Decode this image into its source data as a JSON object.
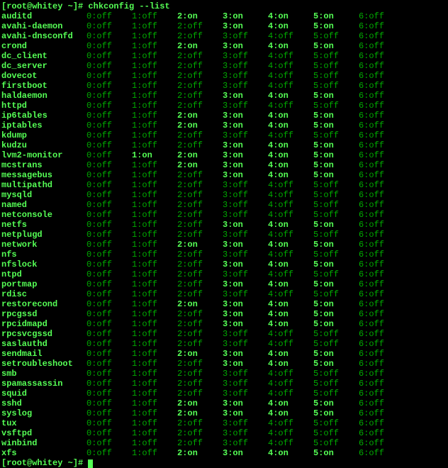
{
  "prompt1": "[root@whitey ~]# chkconfig --list",
  "prompt2": "[root@whitey ~]# ",
  "services": [
    {
      "name": "auditd",
      "levels": [
        "0:off",
        "1:off",
        "2:on",
        "3:on",
        "4:on",
        "5:on",
        "6:off"
      ]
    },
    {
      "name": "avahi-daemon",
      "levels": [
        "0:off",
        "1:off",
        "2:off",
        "3:on",
        "4:on",
        "5:on",
        "6:off"
      ]
    },
    {
      "name": "avahi-dnsconfd",
      "levels": [
        "0:off",
        "1:off",
        "2:off",
        "3:off",
        "4:off",
        "5:off",
        "6:off"
      ]
    },
    {
      "name": "crond",
      "levels": [
        "0:off",
        "1:off",
        "2:on",
        "3:on",
        "4:on",
        "5:on",
        "6:off"
      ]
    },
    {
      "name": "dc_client",
      "levels": [
        "0:off",
        "1:off",
        "2:off",
        "3:off",
        "4:off",
        "5:off",
        "6:off"
      ]
    },
    {
      "name": "dc_server",
      "levels": [
        "0:off",
        "1:off",
        "2:off",
        "3:off",
        "4:off",
        "5:off",
        "6:off"
      ]
    },
    {
      "name": "dovecot",
      "levels": [
        "0:off",
        "1:off",
        "2:off",
        "3:off",
        "4:off",
        "5:off",
        "6:off"
      ]
    },
    {
      "name": "firstboot",
      "levels": [
        "0:off",
        "1:off",
        "2:off",
        "3:off",
        "4:off",
        "5:off",
        "6:off"
      ]
    },
    {
      "name": "haldaemon",
      "levels": [
        "0:off",
        "1:off",
        "2:off",
        "3:on",
        "4:on",
        "5:on",
        "6:off"
      ]
    },
    {
      "name": "httpd",
      "levels": [
        "0:off",
        "1:off",
        "2:off",
        "3:off",
        "4:off",
        "5:off",
        "6:off"
      ]
    },
    {
      "name": "ip6tables",
      "levels": [
        "0:off",
        "1:off",
        "2:on",
        "3:on",
        "4:on",
        "5:on",
        "6:off"
      ]
    },
    {
      "name": "iptables",
      "levels": [
        "0:off",
        "1:off",
        "2:on",
        "3:on",
        "4:on",
        "5:on",
        "6:off"
      ]
    },
    {
      "name": "kdump",
      "levels": [
        "0:off",
        "1:off",
        "2:off",
        "3:off",
        "4:off",
        "5:off",
        "6:off"
      ]
    },
    {
      "name": "kudzu",
      "levels": [
        "0:off",
        "1:off",
        "2:off",
        "3:on",
        "4:on",
        "5:on",
        "6:off"
      ]
    },
    {
      "name": "lvm2-monitor",
      "levels": [
        "0:off",
        "1:on",
        "2:on",
        "3:on",
        "4:on",
        "5:on",
        "6:off"
      ]
    },
    {
      "name": "mcstrans",
      "levels": [
        "0:off",
        "1:off",
        "2:on",
        "3:on",
        "4:on",
        "5:on",
        "6:off"
      ]
    },
    {
      "name": "messagebus",
      "levels": [
        "0:off",
        "1:off",
        "2:off",
        "3:on",
        "4:on",
        "5:on",
        "6:off"
      ]
    },
    {
      "name": "multipathd",
      "levels": [
        "0:off",
        "1:off",
        "2:off",
        "3:off",
        "4:off",
        "5:off",
        "6:off"
      ]
    },
    {
      "name": "mysqld",
      "levels": [
        "0:off",
        "1:off",
        "2:off",
        "3:off",
        "4:off",
        "5:off",
        "6:off"
      ]
    },
    {
      "name": "named",
      "levels": [
        "0:off",
        "1:off",
        "2:off",
        "3:off",
        "4:off",
        "5:off",
        "6:off"
      ]
    },
    {
      "name": "netconsole",
      "levels": [
        "0:off",
        "1:off",
        "2:off",
        "3:off",
        "4:off",
        "5:off",
        "6:off"
      ]
    },
    {
      "name": "netfs",
      "levels": [
        "0:off",
        "1:off",
        "2:off",
        "3:on",
        "4:on",
        "5:on",
        "6:off"
      ]
    },
    {
      "name": "netplugd",
      "levels": [
        "0:off",
        "1:off",
        "2:off",
        "3:off",
        "4:off",
        "5:off",
        "6:off"
      ]
    },
    {
      "name": "network",
      "levels": [
        "0:off",
        "1:off",
        "2:on",
        "3:on",
        "4:on",
        "5:on",
        "6:off"
      ]
    },
    {
      "name": "nfs",
      "levels": [
        "0:off",
        "1:off",
        "2:off",
        "3:off",
        "4:off",
        "5:off",
        "6:off"
      ]
    },
    {
      "name": "nfslock",
      "levels": [
        "0:off",
        "1:off",
        "2:off",
        "3:on",
        "4:on",
        "5:on",
        "6:off"
      ]
    },
    {
      "name": "ntpd",
      "levels": [
        "0:off",
        "1:off",
        "2:off",
        "3:off",
        "4:off",
        "5:off",
        "6:off"
      ]
    },
    {
      "name": "portmap",
      "levels": [
        "0:off",
        "1:off",
        "2:off",
        "3:on",
        "4:on",
        "5:on",
        "6:off"
      ]
    },
    {
      "name": "rdisc",
      "levels": [
        "0:off",
        "1:off",
        "2:off",
        "3:off",
        "4:off",
        "5:off",
        "6:off"
      ]
    },
    {
      "name": "restorecond",
      "levels": [
        "0:off",
        "1:off",
        "2:on",
        "3:on",
        "4:on",
        "5:on",
        "6:off"
      ]
    },
    {
      "name": "rpcgssd",
      "levels": [
        "0:off",
        "1:off",
        "2:off",
        "3:on",
        "4:on",
        "5:on",
        "6:off"
      ]
    },
    {
      "name": "rpcidmapd",
      "levels": [
        "0:off",
        "1:off",
        "2:off",
        "3:on",
        "4:on",
        "5:on",
        "6:off"
      ]
    },
    {
      "name": "rpcsvcgssd",
      "levels": [
        "0:off",
        "1:off",
        "2:off",
        "3:off",
        "4:off",
        "5:off",
        "6:off"
      ]
    },
    {
      "name": "saslauthd",
      "levels": [
        "0:off",
        "1:off",
        "2:off",
        "3:off",
        "4:off",
        "5:off",
        "6:off"
      ]
    },
    {
      "name": "sendmail",
      "levels": [
        "0:off",
        "1:off",
        "2:on",
        "3:on",
        "4:on",
        "5:on",
        "6:off"
      ]
    },
    {
      "name": "setroubleshoot",
      "levels": [
        "0:off",
        "1:off",
        "2:off",
        "3:on",
        "4:on",
        "5:on",
        "6:off"
      ]
    },
    {
      "name": "smb",
      "levels": [
        "0:off",
        "1:off",
        "2:off",
        "3:off",
        "4:off",
        "5:off",
        "6:off"
      ]
    },
    {
      "name": "spamassassin",
      "levels": [
        "0:off",
        "1:off",
        "2:off",
        "3:off",
        "4:off",
        "5:off",
        "6:off"
      ]
    },
    {
      "name": "squid",
      "levels": [
        "0:off",
        "1:off",
        "2:off",
        "3:off",
        "4:off",
        "5:off",
        "6:off"
      ]
    },
    {
      "name": "sshd",
      "levels": [
        "0:off",
        "1:off",
        "2:on",
        "3:on",
        "4:on",
        "5:on",
        "6:off"
      ]
    },
    {
      "name": "syslog",
      "levels": [
        "0:off",
        "1:off",
        "2:on",
        "3:on",
        "4:on",
        "5:on",
        "6:off"
      ]
    },
    {
      "name": "tux",
      "levels": [
        "0:off",
        "1:off",
        "2:off",
        "3:off",
        "4:off",
        "5:off",
        "6:off"
      ]
    },
    {
      "name": "vsftpd",
      "levels": [
        "0:off",
        "1:off",
        "2:off",
        "3:off",
        "4:off",
        "5:off",
        "6:off"
      ]
    },
    {
      "name": "winbind",
      "levels": [
        "0:off",
        "1:off",
        "2:off",
        "3:off",
        "4:off",
        "5:off",
        "6:off"
      ]
    },
    {
      "name": "xfs",
      "levels": [
        "0:off",
        "1:off",
        "2:on",
        "3:on",
        "4:on",
        "5:on",
        "6:off"
      ]
    }
  ]
}
